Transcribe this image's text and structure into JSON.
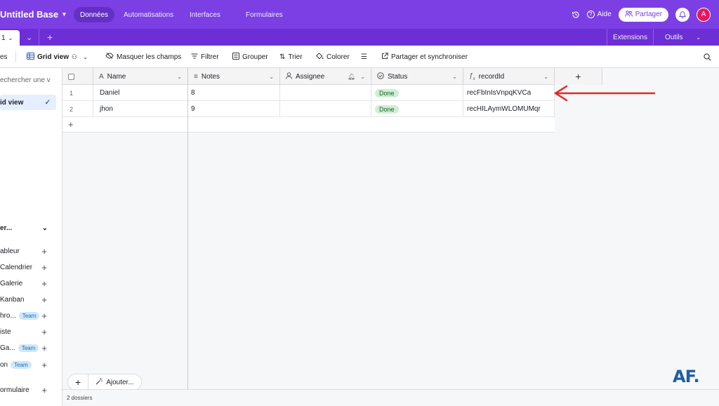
{
  "topbar": {
    "base_title": "Untitled Base",
    "tabs": [
      "Données",
      "Automatisations",
      "Interfaces",
      "Formulaires"
    ],
    "help_label": "Aide",
    "share_label": "Partager",
    "avatar_letter": "A",
    "brand_color": "#7b3fe4"
  },
  "tabbar": {
    "active_tab": "1",
    "extensions_label": "Extensions",
    "tools_label": "Outils"
  },
  "toolbar": {
    "views_label": "es",
    "view_name": "Grid view",
    "hide_fields": "Masquer les champs",
    "filter": "Filtrer",
    "group": "Grouper",
    "sort": "Trier",
    "color": "Colorer",
    "share_sync": "Partager et synchroniser"
  },
  "sidebar": {
    "search_placeholder": "echercher une v",
    "current_view": "id view",
    "create_header": "er...",
    "create_items": [
      {
        "label": "ableur",
        "badge": ""
      },
      {
        "label": "Calendrier",
        "badge": ""
      },
      {
        "label": "Galerie",
        "badge": ""
      },
      {
        "label": "Kanban",
        "badge": ""
      },
      {
        "label": "hro...",
        "badge": "Team"
      },
      {
        "label": "iste",
        "badge": ""
      },
      {
        "label": "Ga...",
        "badge": "Team"
      },
      {
        "label": "on",
        "badge": "Team"
      },
      {
        "label": "ormulaire",
        "badge": ""
      }
    ]
  },
  "grid": {
    "columns": [
      {
        "name": "Name",
        "icon": "text-field-icon"
      },
      {
        "name": "Notes",
        "icon": "long-text-icon"
      },
      {
        "name": "Assignee",
        "icon": "user-icon"
      },
      {
        "name": "Status",
        "icon": "status-icon"
      },
      {
        "name": "recordId",
        "icon": "formula-icon"
      }
    ],
    "rows": [
      {
        "num": "1",
        "name": "Daniel",
        "notes": "8",
        "assignee": "",
        "status": "Done",
        "recordId": "recFbInIsVnpqKVCa"
      },
      {
        "num": "2",
        "name": "jhon",
        "notes": "9",
        "assignee": "",
        "status": "Done",
        "recordId": "recHILAymWLOMUMqr"
      }
    ],
    "status_color": "#cdf0d2"
  },
  "bottom": {
    "add_label": "Ajouter...",
    "record_count": "2 dossiers"
  },
  "watermark": "AF."
}
